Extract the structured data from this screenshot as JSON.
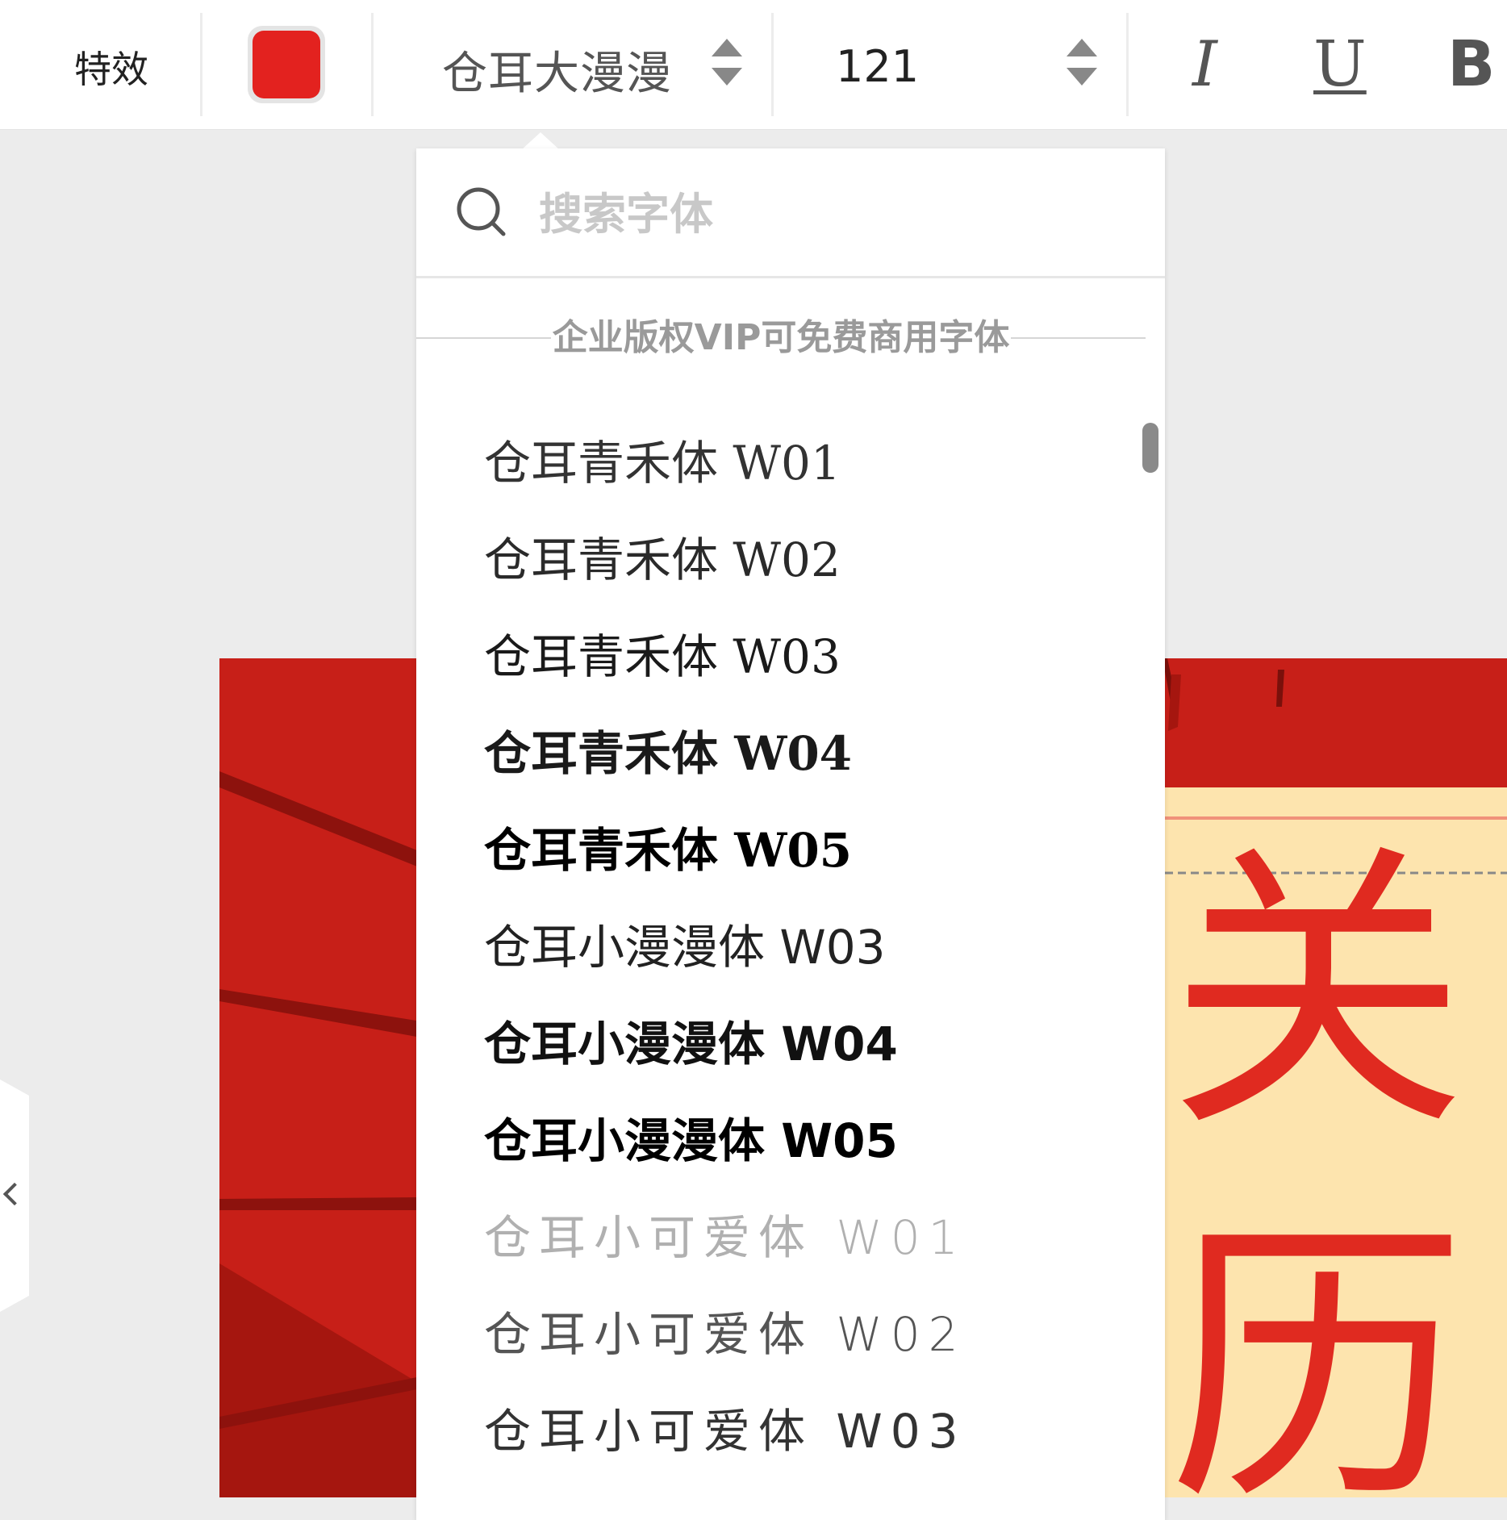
{
  "toolbar": {
    "effects_label": "特效",
    "text_color": "#e3221f",
    "font_family_value": "仓耳大漫漫",
    "font_size_value": "121",
    "italic_label": "I",
    "underline_label": "U",
    "bold_label": "B"
  },
  "font_dropdown": {
    "search_placeholder": "搜索字体",
    "section_title": "企业版权VIP可免费商用字体",
    "fonts": [
      {
        "label": "仓耳青禾体 W01"
      },
      {
        "label": "仓耳青禾体 W02"
      },
      {
        "label": "仓耳青禾体 W03"
      },
      {
        "label": "仓耳青禾体 W04"
      },
      {
        "label": "仓耳青禾体 W05"
      },
      {
        "label": "仓耳小漫漫体 W03"
      },
      {
        "label": "仓耳小漫漫体 W04"
      },
      {
        "label": "仓耳小漫漫体 W05"
      },
      {
        "label": "仓耳小可爱体 W01"
      },
      {
        "label": "仓耳小可爱体 W02"
      },
      {
        "label": "仓耳小可爱体 W03"
      }
    ]
  },
  "canvas": {
    "headline_chars": [
      "关",
      "历"
    ],
    "background_color": "#c71f18",
    "card_color": "#fde4ae"
  }
}
